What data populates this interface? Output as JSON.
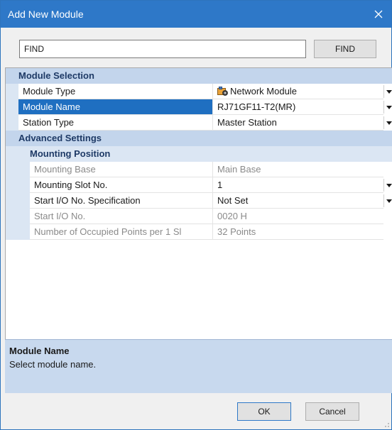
{
  "window": {
    "title": "Add New Module"
  },
  "search": {
    "value": "FIND",
    "button_label": "FIND"
  },
  "grid": {
    "module_selection": {
      "header": "Module Selection",
      "rows": [
        {
          "name": "Module Type",
          "value": "Network Module"
        },
        {
          "name": "Module Name",
          "value": "RJ71GF11-T2(MR)"
        },
        {
          "name": "Station Type",
          "value": "Master Station"
        }
      ]
    },
    "advanced_settings": {
      "header": "Advanced Settings",
      "mounting_position": {
        "header": "Mounting Position",
        "rows": [
          {
            "name": "Mounting Base",
            "value": "Main Base"
          },
          {
            "name": "Mounting Slot No.",
            "value": "1"
          },
          {
            "name": "Start I/O No. Specification",
            "value": "Not Set"
          },
          {
            "name": "Start I/O No.",
            "value": "0020 H"
          },
          {
            "name": "Number of Occupied Points per 1 Sl",
            "value": "32 Points"
          }
        ]
      }
    }
  },
  "description": {
    "title": "Module Name",
    "text": "Select module name."
  },
  "footer": {
    "ok_label": "OK",
    "cancel_label": "Cancel"
  },
  "colors": {
    "title_bar": "#2e78c8",
    "selection": "#1f6fc1",
    "category": "#c3d5ec"
  }
}
